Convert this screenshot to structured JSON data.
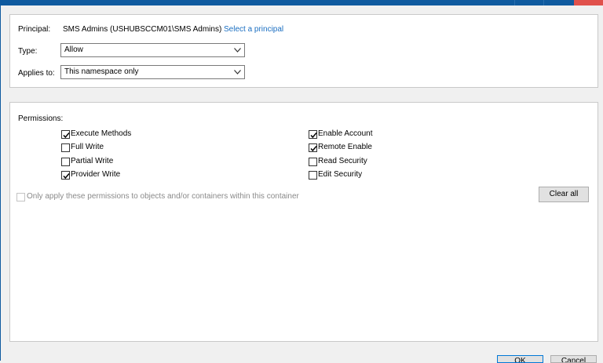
{
  "principal": {
    "label": "Principal:",
    "value": "SMS Admins (USHUBSCCM01\\SMS Admins)",
    "select_link": "Select a principal"
  },
  "type": {
    "label": "Type:",
    "value": "Allow"
  },
  "applies_to": {
    "label": "Applies to:",
    "value": "This namespace only"
  },
  "permissions": {
    "label": "Permissions:",
    "left": [
      {
        "label": "Execute Methods",
        "checked": true
      },
      {
        "label": "Full Write",
        "checked": false
      },
      {
        "label": "Partial Write",
        "checked": false
      },
      {
        "label": "Provider Write",
        "checked": true
      }
    ],
    "right": [
      {
        "label": "Enable Account",
        "checked": true
      },
      {
        "label": "Remote Enable",
        "checked": true
      },
      {
        "label": "Read Security",
        "checked": false
      },
      {
        "label": "Edit Security",
        "checked": false
      }
    ]
  },
  "only_apply": {
    "label": "Only apply these permissions to objects and/or containers within this container",
    "checked": false
  },
  "buttons": {
    "clear_all": "Clear all",
    "ok": "OK",
    "cancel": "Cancel"
  },
  "icons": {
    "check": "check-icon",
    "dropdown": "chevron-down-icon"
  },
  "colors": {
    "title_bar": "#0f5a9f",
    "link": "#1a6ec1",
    "close": "#e0514b"
  }
}
